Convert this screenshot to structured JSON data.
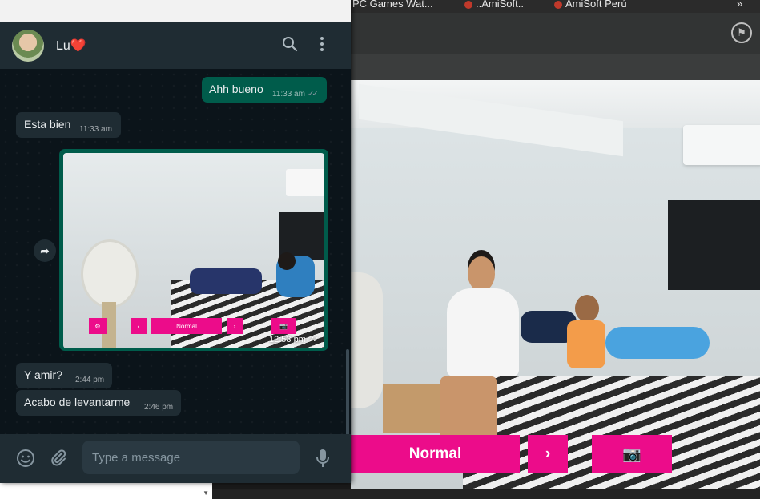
{
  "bookmarks": [
    {
      "label": "PC Games Wat..."
    },
    {
      "label": "..AmiSoft.."
    },
    {
      "label": "AmiSoft Perú"
    }
  ],
  "bookmarks_more": "»",
  "camera": {
    "mode_label": "Normal",
    "next_glyph": "›",
    "snapshot_glyph": "📷",
    "flag_glyph": "⚑",
    "accent_color": "#ec0c8a"
  },
  "chat": {
    "contact_name": "Lu❤️",
    "header_icons": [
      "search-icon",
      "menu-icon"
    ],
    "messages": [
      {
        "direction": "outgoing",
        "text": "Ahh bueno",
        "time": "11:33 am",
        "status": "read"
      },
      {
        "direction": "incoming",
        "text": "Esta bien",
        "time": "11:33 am"
      },
      {
        "direction": "outgoing",
        "type": "image",
        "time": "12:53 pm",
        "status": "read",
        "image_controls": {
          "mode_label": "Normal"
        }
      },
      {
        "direction": "incoming",
        "text": "Y amir?",
        "time": "2:44 pm"
      },
      {
        "direction": "incoming",
        "text": "Acabo de levantarme",
        "time": "2:46 pm"
      }
    ],
    "input_placeholder": "Type a message",
    "footer_icons": [
      "emoji-icon",
      "attach-icon",
      "mic-icon"
    ],
    "colors": {
      "header_bg": "#1f2c33",
      "outgoing_bubble": "#005c4b",
      "incoming_bubble": "#1f2c33",
      "chat_bg": "#0b141a"
    }
  }
}
